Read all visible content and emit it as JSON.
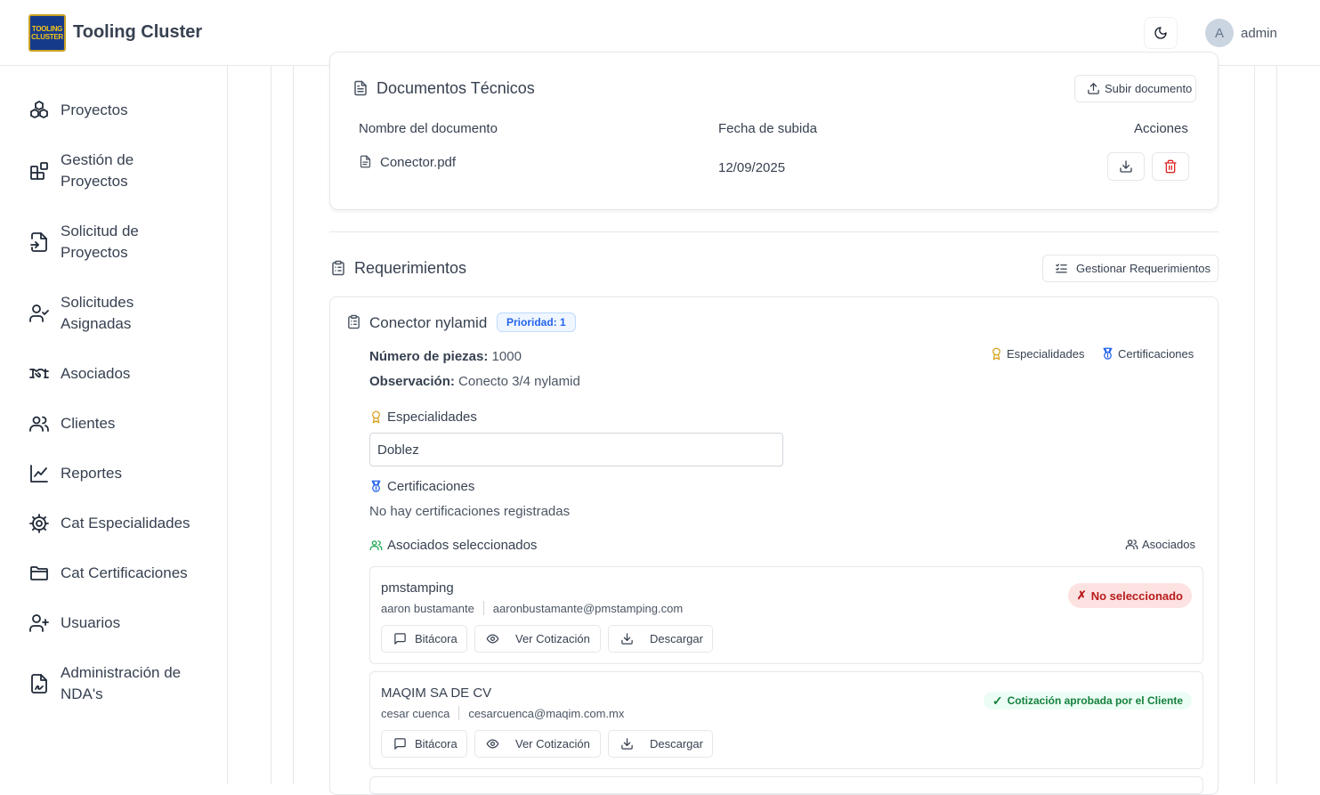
{
  "header": {
    "logo_line1": "TOOLING",
    "logo_line2": "CLUSTER",
    "title": "Tooling Cluster",
    "avatar_initial": "A",
    "username": "admin",
    "theme_icon": "moon-icon"
  },
  "sidebar": {
    "items": [
      {
        "label": "Proyectos",
        "icon": "boxes-icon"
      },
      {
        "label": "Gestión de Proyectos",
        "icon": "blocks-icon"
      },
      {
        "label": "Solicitud de Proyectos",
        "icon": "file-input-icon"
      },
      {
        "label": "Solicitudes Asignadas",
        "icon": "user-check-icon"
      },
      {
        "label": "Asociados",
        "icon": "handshake-icon"
      },
      {
        "label": "Clientes",
        "icon": "users-icon"
      },
      {
        "label": "Reportes",
        "icon": "line-chart-icon"
      },
      {
        "label": "Cat Especialidades",
        "icon": "cog-icon"
      },
      {
        "label": "Cat Certificaciones",
        "icon": "folder-icon"
      },
      {
        "label": "Usuarios",
        "icon": "user-plus-icon"
      },
      {
        "label": "Administración de NDA's",
        "icon": "file-signature-icon"
      }
    ]
  },
  "documents": {
    "title": "Documentos Técnicos",
    "upload_label": "Subir documento",
    "columns": [
      "Nombre del documento",
      "Fecha de subida",
      "Acciones"
    ],
    "rows": [
      {
        "name": "Conector.pdf",
        "date": "12/09/2025"
      }
    ]
  },
  "requirements": {
    "title": "Requerimientos",
    "manage_label": "Gestionar Requerimientos",
    "item": {
      "name": "Conector nylamid",
      "priority": "Prioridad: 1",
      "pieces_label": "Número de piezas:",
      "pieces_value": "1000",
      "observation_label": "Observación:",
      "observation_value": "Conecto 3/4 nylamid",
      "link_specialties": "Especialidades",
      "link_certifications": "Certificaciones",
      "specialties_title": "Especialidades",
      "specialty_value": "Doblez",
      "certifications_title": "Certificaciones",
      "certifications_empty": "No hay certificaciones registradas",
      "associates_title": "Asociados seleccionados",
      "associates_link": "Asociados"
    },
    "associates": [
      {
        "company": "pmstamping",
        "contact": "aaron bustamante",
        "email": "aaronbustamante@pmstamping.com",
        "status": "No seleccionado",
        "status_mark": "✗"
      },
      {
        "company": "MAQIM SA DE CV",
        "contact": "cesar cuenca",
        "email": "cesarcuenca@maqim.com.mx",
        "status": "Cotización aprobada por el Cliente",
        "status_mark": "✓"
      }
    ],
    "actions": {
      "log": "Bitácora",
      "view_quote": "Ver Cotización",
      "download": "Descargar"
    }
  },
  "colors": {
    "accent_blue": "#2563eb",
    "status_red": "#b91c1c",
    "status_green": "#15803d",
    "delete_red": "#dc2626",
    "amber": "#d4a017"
  }
}
